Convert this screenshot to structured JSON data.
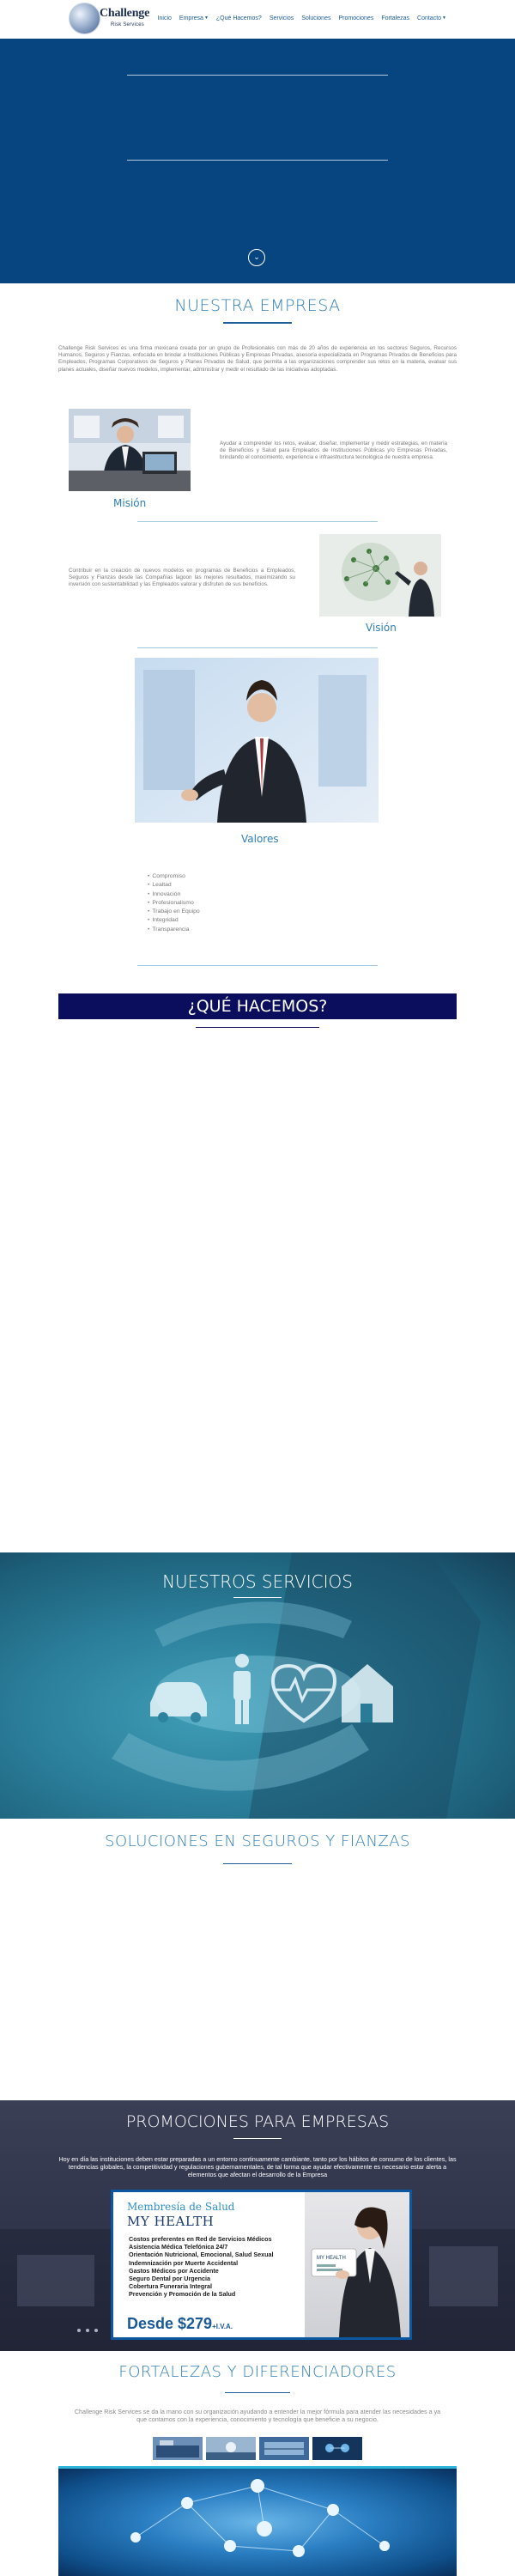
{
  "nav": {
    "logo_title": "Challenge",
    "logo_subtitle": "Risk Services",
    "items": [
      {
        "label": "Inicio",
        "dropdown": false
      },
      {
        "label": "Empresa",
        "dropdown": true
      },
      {
        "label": "¿Qué Hacemos?",
        "dropdown": false
      },
      {
        "label": "Servicios",
        "dropdown": false
      },
      {
        "label": "Soluciones",
        "dropdown": false
      },
      {
        "label": "Promociones",
        "dropdown": false
      },
      {
        "label": "Fortalezas",
        "dropdown": false
      },
      {
        "label": "Contacto",
        "dropdown": true
      }
    ]
  },
  "colors": {
    "hero_bg": "#064580",
    "accent": "#2e7fb8",
    "que_bar": "#0b0e5c"
  },
  "hero": {
    "scroll_icon": "chevron-down-circle-icon"
  },
  "empresa": {
    "title": "NUESTRA EMPRESA",
    "intro": "Challenge Risk Services es una firma mexicana creada por un grupo de Profesionales con más de 20 años de experiencia en los sectores Seguros, Recursos Humanos, Seguros y Fianzas, enfocada en brindar a Instituciones Públicas y Empresas Privadas, asesoría especializada en Programas Privados de Beneficios para Empleados, Programas Corporativos de Seguros y Planes Privados de Salud, que permita a las organizaciones comprender sus retos en la materia, evaluar sus planes actuales, diseñar nuevos modelos, implementar, administrar y medir el resultado de las iniciativas adoptadas.",
    "mision_text": "Ayudar a comprender los retos, evaluar, diseñar, implementar y medir estrategias, en materia de Beneficios y Salud para Empleados de Instituciones Públicas y/o Empresas Privadas, brindando el conocimiento, experiencia e infraestructura tecnológica de nuestra empresa.",
    "mision_label": "Misión",
    "vision_text": "Contribuir en la creación de nuevos modelos en programas de Beneficios a Empleados, Seguros y Fianzas desde las Compañías lagoon las mejores resultados, maximizando su inversión con sustentabilidad y las Empleados valorar y disfruten de sus beneficios.",
    "vision_label": "Visión",
    "valores_label": "Valores",
    "valores": [
      "Compromiso",
      "Lealtad",
      "Innovación",
      "Profesionalismo",
      "Trabajo en Equipo",
      "Integridad",
      "Transparencia"
    ]
  },
  "que_hacemos": {
    "title": "¿QUÉ HACEMOS?"
  },
  "servicios": {
    "title": "NUESTROS SERVICIOS"
  },
  "soluciones": {
    "title": "SOLUCIONES EN SEGUROS Y FIANZAS"
  },
  "promociones": {
    "title": "PROMOCIONES PARA EMPRESAS",
    "text": "Hoy en día las instituciones deben estar preparadas a un entorno continuamente cambiante, tanto por los hábitos de consumo de los clientes, las tendencias globales, la competitividad y regulaciones gubernamentales, de tal forma que ayudar efectivamente es necesario estar alerta a elementos que afectan el desarrollo de la Empresa",
    "card": {
      "kicker": "Membresía de Salud",
      "brand": "MY HEALTH",
      "features": [
        "Costos preferentes en Red de Servicios Médicos",
        "Asistencia Médica Telefónica 24/7",
        "Orientación Nutricional, Emocional, Salud Sexual",
        "Indemnización por Muerte Accidental",
        "Gastos Médicos por Accidente",
        "Seguro Dental por Urgencia",
        "Cobertura Funeraria Integral",
        "Prevención y Promoción de la Salud"
      ],
      "price": "Desde $279",
      "price_suffix": "+I.V.A."
    },
    "slides": 3
  },
  "fortalezas": {
    "title": "FORTALEZAS Y DIFERENCIADORES",
    "text": "Challenge Risk Services se da la mano con su organización ayudando a entender la mejor fórmula para atender las necesidades a ya que contamos con la experiencia, conocimiento y tecnología que beneficie a su negocio."
  }
}
